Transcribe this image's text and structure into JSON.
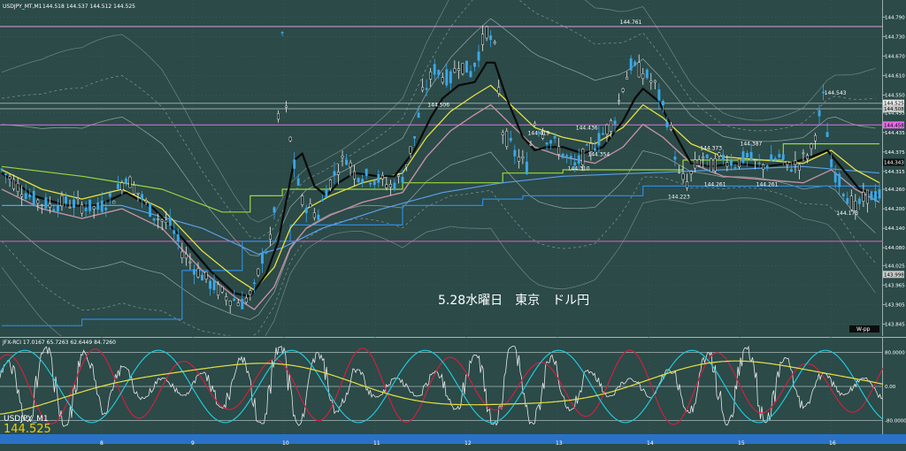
{
  "chart_data": [
    {
      "type": "candlestick",
      "title": "USDJPY_MT,M1",
      "header_values": "144.518 144.537 144.512 144.525",
      "caption": "5.28水曜日　東京　ドル円",
      "y_ticks": [
        "144.790",
        "144.730",
        "144.670",
        "144.610",
        "144.550",
        "144.495",
        "144.435",
        "144.375",
        "144.315",
        "144.260",
        "144.200",
        "144.140",
        "144.080",
        "144.025",
        "143.965",
        "143.905",
        "143.845"
      ],
      "ylim": [
        143.83,
        144.81
      ],
      "right_markers": [
        {
          "label": "144.525",
          "value": 144.525,
          "color": "#e8e8e8",
          "text": "#000000"
        },
        {
          "label": "144.508",
          "value": 144.508,
          "color": "#c8c8c8",
          "text": "#000000"
        },
        {
          "label": "144.458",
          "value": 144.458,
          "color": "#e76ae7",
          "text": "#000000"
        },
        {
          "label": "144.343",
          "value": 144.343,
          "color": "#111111",
          "text": "#ffffff"
        },
        {
          "label": "143.998",
          "value": 143.998,
          "color": "#c8c8c8",
          "text": "#000000"
        }
      ],
      "annotations": [
        {
          "label": "144.761",
          "x": 156,
          "value": 144.761
        },
        {
          "label": "144.506",
          "x": 108,
          "value": 144.506
        },
        {
          "label": "144.543",
          "x": 207,
          "value": 144.543
        },
        {
          "label": "144.419",
          "x": 133,
          "value": 144.419
        },
        {
          "label": "144.436",
          "x": 145,
          "value": 144.436
        },
        {
          "label": "144.354",
          "x": 148,
          "value": 144.354
        },
        {
          "label": "144.310",
          "x": 143,
          "value": 144.31
        },
        {
          "label": "144.373",
          "x": 176,
          "value": 144.373
        },
        {
          "label": "144.387",
          "x": 186,
          "value": 144.387
        },
        {
          "label": "144.261",
          "x": 177,
          "value": 144.261
        },
        {
          "label": "144.261",
          "x": 190,
          "value": 144.261
        },
        {
          "label": "144.223",
          "x": 168,
          "value": 144.223
        },
        {
          "label": "144.173",
          "x": 210,
          "value": 144.173
        }
      ],
      "price_path": [
        [
          0,
          144.32
        ],
        [
          4,
          144.27
        ],
        [
          8,
          144.23
        ],
        [
          12,
          144.21
        ],
        [
          16,
          144.22
        ],
        [
          20,
          144.21
        ],
        [
          24,
          144.2
        ],
        [
          28,
          144.24
        ],
        [
          31,
          144.3
        ],
        [
          34,
          144.25
        ],
        [
          38,
          144.18
        ],
        [
          42,
          144.15
        ],
        [
          45,
          144.07
        ],
        [
          48,
          144.02
        ],
        [
          52,
          143.97
        ],
        [
          56,
          143.93
        ],
        [
          60,
          143.91
        ],
        [
          63,
          143.95
        ],
        [
          65,
          144.05
        ],
        [
          67,
          144.1
        ],
        [
          68,
          144.2
        ],
        [
          70,
          144.74
        ],
        [
          71,
          144.5
        ],
        [
          73,
          144.33
        ],
        [
          75,
          144.22
        ],
        [
          77,
          144.2
        ],
        [
          79,
          144.18
        ],
        [
          81,
          144.26
        ],
        [
          84,
          144.33
        ],
        [
          86,
          144.36
        ],
        [
          88,
          144.31
        ],
        [
          91,
          144.3
        ],
        [
          94,
          144.29
        ],
        [
          97,
          144.27
        ],
        [
          100,
          144.3
        ],
        [
          103,
          144.42
        ],
        [
          105,
          144.55
        ],
        [
          108,
          144.63
        ],
        [
          110,
          144.61
        ],
        [
          112,
          144.6
        ],
        [
          114,
          144.65
        ],
        [
          117,
          144.62
        ],
        [
          119,
          144.68
        ],
        [
          121,
          144.75
        ],
        [
          123,
          144.69
        ],
        [
          125,
          144.44
        ],
        [
          128,
          144.37
        ],
        [
          131,
          144.33
        ],
        [
          133,
          144.47
        ],
        [
          136,
          144.42
        ],
        [
          138,
          144.4
        ],
        [
          140,
          144.37
        ],
        [
          143,
          144.33
        ],
        [
          145,
          144.36
        ],
        [
          148,
          144.4
        ],
        [
          150,
          144.43
        ],
        [
          153,
          144.48
        ],
        [
          155,
          144.58
        ],
        [
          157,
          144.64
        ],
        [
          160,
          144.62
        ],
        [
          163,
          144.58
        ],
        [
          165,
          144.51
        ],
        [
          167,
          144.44
        ],
        [
          169,
          144.3
        ],
        [
          171,
          144.28
        ],
        [
          173,
          144.33
        ],
        [
          175,
          144.36
        ],
        [
          177,
          144.33
        ],
        [
          180,
          144.36
        ],
        [
          183,
          144.34
        ],
        [
          186,
          144.36
        ],
        [
          189,
          144.33
        ],
        [
          191,
          144.34
        ],
        [
          194,
          144.36
        ],
        [
          196,
          144.33
        ],
        [
          199,
          144.34
        ],
        [
          202,
          144.38
        ],
        [
          205,
          144.54
        ],
        [
          207,
          144.33
        ],
        [
          210,
          144.26
        ],
        [
          213,
          144.2
        ],
        [
          216,
          144.24
        ],
        [
          219,
          144.24
        ]
      ],
      "ema_black": [
        [
          0,
          144.31
        ],
        [
          8,
          144.24
        ],
        [
          16,
          144.21
        ],
        [
          24,
          144.21
        ],
        [
          31,
          144.25
        ],
        [
          38,
          144.2
        ],
        [
          45,
          144.11
        ],
        [
          52,
          144.01
        ],
        [
          58,
          143.94
        ],
        [
          62,
          143.93
        ],
        [
          66,
          144.0
        ],
        [
          69,
          144.1
        ],
        [
          73,
          144.35
        ],
        [
          75,
          144.37
        ],
        [
          78,
          144.27
        ],
        [
          81,
          144.24
        ],
        [
          84,
          144.28
        ],
        [
          88,
          144.31
        ],
        [
          94,
          144.3
        ],
        [
          98,
          144.3
        ],
        [
          103,
          144.38
        ],
        [
          107,
          144.48
        ],
        [
          110,
          144.54
        ],
        [
          114,
          144.58
        ],
        [
          118,
          144.59
        ],
        [
          121,
          144.65
        ],
        [
          123,
          144.65
        ],
        [
          126,
          144.54
        ],
        [
          130,
          144.42
        ],
        [
          133,
          144.38
        ],
        [
          136,
          144.39
        ],
        [
          140,
          144.39
        ],
        [
          145,
          144.37
        ],
        [
          150,
          144.39
        ],
        [
          155,
          144.47
        ],
        [
          158,
          144.54
        ],
        [
          160,
          144.57
        ],
        [
          164,
          144.53
        ],
        [
          168,
          144.43
        ],
        [
          172,
          144.34
        ],
        [
          177,
          144.33
        ],
        [
          183,
          144.34
        ],
        [
          190,
          144.33
        ],
        [
          197,
          144.34
        ],
        [
          202,
          144.36
        ],
        [
          206,
          144.38
        ],
        [
          210,
          144.32
        ],
        [
          214,
          144.26
        ],
        [
          219,
          144.24
        ]
      ],
      "ma_yellow": [
        [
          0,
          144.32
        ],
        [
          10,
          144.26
        ],
        [
          20,
          144.23
        ],
        [
          30,
          144.26
        ],
        [
          40,
          144.2
        ],
        [
          50,
          144.07
        ],
        [
          58,
          143.99
        ],
        [
          63,
          143.95
        ],
        [
          68,
          144.02
        ],
        [
          72,
          144.14
        ],
        [
          76,
          144.2
        ],
        [
          82,
          144.24
        ],
        [
          90,
          144.28
        ],
        [
          100,
          144.31
        ],
        [
          106,
          144.42
        ],
        [
          112,
          144.5
        ],
        [
          118,
          144.55
        ],
        [
          122,
          144.58
        ],
        [
          127,
          144.52
        ],
        [
          133,
          144.45
        ],
        [
          140,
          144.42
        ],
        [
          148,
          144.4
        ],
        [
          155,
          144.45
        ],
        [
          160,
          144.52
        ],
        [
          165,
          144.48
        ],
        [
          172,
          144.4
        ],
        [
          180,
          144.36
        ],
        [
          190,
          144.35
        ],
        [
          200,
          144.34
        ],
        [
          207,
          144.38
        ],
        [
          213,
          144.32
        ],
        [
          219,
          144.28
        ]
      ],
      "ma_blue": [
        [
          0,
          144.21
        ],
        [
          30,
          144.21
        ],
        [
          50,
          144.14
        ],
        [
          64,
          144.06
        ],
        [
          70,
          144.08
        ],
        [
          80,
          144.14
        ],
        [
          95,
          144.2
        ],
        [
          110,
          144.25
        ],
        [
          125,
          144.28
        ],
        [
          140,
          144.3
        ],
        [
          160,
          144.31
        ],
        [
          180,
          144.32
        ],
        [
          200,
          144.33
        ],
        [
          219,
          144.31
        ]
      ],
      "step_blue": [
        [
          0,
          143.84
        ],
        [
          20,
          143.84
        ],
        [
          20,
          143.86
        ],
        [
          45,
          143.86
        ],
        [
          45,
          144.01
        ],
        [
          60,
          144.01
        ],
        [
          60,
          144.1
        ],
        [
          72,
          144.1
        ],
        [
          72,
          144.15
        ],
        [
          100,
          144.15
        ],
        [
          100,
          144.21
        ],
        [
          120,
          144.21
        ],
        [
          120,
          144.23
        ],
        [
          130,
          144.23
        ],
        [
          130,
          144.24
        ],
        [
          160,
          144.24
        ],
        [
          160,
          144.27
        ],
        [
          219,
          144.27
        ]
      ],
      "step_green": [
        [
          0,
          144.33
        ],
        [
          20,
          144.3
        ],
        [
          40,
          144.26
        ],
        [
          55,
          144.19
        ],
        [
          62,
          144.19
        ],
        [
          62,
          144.24
        ],
        [
          70,
          144.24
        ],
        [
          70,
          144.26
        ],
        [
          100,
          144.26
        ],
        [
          100,
          144.28
        ],
        [
          125,
          144.28
        ],
        [
          125,
          144.31
        ],
        [
          140,
          144.31
        ],
        [
          140,
          144.32
        ],
        [
          170,
          144.32
        ],
        [
          170,
          144.35
        ],
        [
          195,
          144.35
        ],
        [
          195,
          144.4
        ],
        [
          219,
          144.4
        ]
      ],
      "levels": [
        {
          "value": 144.761,
          "color": "#d9a0d9"
        },
        {
          "value": 144.458,
          "color": "#e070e0"
        },
        {
          "value": 144.508,
          "color": "#9aa6a6"
        },
        {
          "value": 144.525,
          "color": "#9aa6a6"
        },
        {
          "value": 144.1,
          "color": "#e060c0"
        }
      ],
      "x_labels": [
        "8",
        "9",
        "10",
        "11",
        "12",
        "13",
        "14",
        "15",
        "16"
      ],
      "badge": "W-pp"
    },
    {
      "type": "line",
      "title": "JFX-RCI 17.0167 65.7263 62.6449 84.7260",
      "symbol": "USDJPY_M1",
      "price": "144.525",
      "ylim": [
        -100,
        100
      ],
      "y_ticks": [
        {
          "label": "80.0000",
          "value": 80
        },
        {
          "label": "0.00",
          "value": 0
        },
        {
          "label": "-80.0000",
          "value": -80
        }
      ],
      "series": [
        {
          "color": "#e8e8e8",
          "period": 4
        },
        {
          "color": "#d02040",
          "period": 9
        },
        {
          "color": "#22c8d8",
          "period": 14
        },
        {
          "color": "#e8e040",
          "period": 40
        }
      ]
    }
  ]
}
